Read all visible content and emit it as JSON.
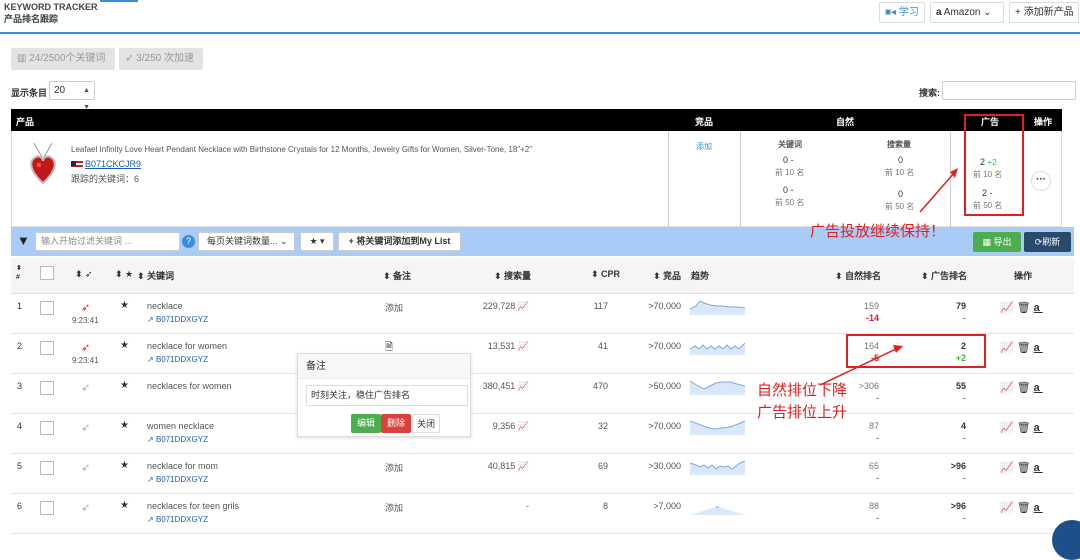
{
  "header": {
    "brand_en": "KEYWORD TRACKER",
    "brand_cn": "产品排名跟踪",
    "learn": "学习",
    "marketplace": "Amazon",
    "add_product": "添加新产品"
  },
  "stats": {
    "keywords": "24/2500个关键词",
    "boosts": "3/250 次加速"
  },
  "controls": {
    "show_label": "显示条目",
    "page_size": "20",
    "search_label": "搜索:"
  },
  "product_header": {
    "product": "产品",
    "competitor": "竞品",
    "organic": "自然",
    "ads": "广告",
    "actions": "操作"
  },
  "product": {
    "title": "Leafael Infinity Love Heart Pendant Necklace with Birthstone Crystals for 12 Months, Jewelry Gifts for Women, Silver-Tone, 18\"+2\"",
    "asin": "B071CKCJR9",
    "tracked": "跟踪的关键词：6",
    "competitor_add": "添加",
    "organic": {
      "kw_label": "关键词",
      "sv_label": "搜索量",
      "top10_kw": "0",
      "top10_kw_delta": "-",
      "top10_label": "前 10 名",
      "top10_sv": "0",
      "top50_kw": "0",
      "top50_kw_delta": "-",
      "top50_label": "前 50 名",
      "top50_sv": "0"
    },
    "ads": {
      "top10": "2",
      "top10_delta": "+2",
      "top10_label": "前 10 名",
      "top50": "2",
      "top50_delta": "-",
      "top50_label": "前 50 名"
    }
  },
  "toolbar": {
    "filter_placeholder": "输入开始过滤关键词 ...",
    "per_page": "每页关键词数量...",
    "add_mylist": "将关键词添加到My List",
    "export": "导出",
    "refresh": "刷新"
  },
  "columns": {
    "num": "#",
    "keyword": "关键词",
    "note": "备注",
    "search_volume": "搜索量",
    "cpr": "CPR",
    "competitor": "竞品",
    "trend": "趋势",
    "organic_rank": "自然排名",
    "ad_rank": "广告排名",
    "actions": "操作"
  },
  "rows": [
    {
      "n": "1",
      "time": "9:23:41",
      "kw": "necklace",
      "asin": "B071DDXGYZ",
      "note": "添加",
      "sv": "229,728",
      "cpr": "117",
      "comp": ">70,000",
      "org": "159",
      "org_d": "-14",
      "ad": "79",
      "ad_d": "-"
    },
    {
      "n": "2",
      "time": "9:23:41",
      "kw": "necklace for women",
      "asin": "B071DDXGYZ",
      "note": "",
      "sv": "13,531",
      "cpr": "41",
      "comp": ">70,000",
      "org": "164",
      "org_d": "-5",
      "ad": "2",
      "ad_d": "+2"
    },
    {
      "n": "3",
      "time": "",
      "kw": "necklaces for women",
      "asin": "",
      "note": "",
      "sv": "380,451",
      "cpr": "470",
      "comp": ">50,000",
      "org": ">306",
      "org_d": "-",
      "ad": "55",
      "ad_d": "-"
    },
    {
      "n": "4",
      "time": "",
      "kw": "women necklace",
      "asin": "B071DDXGYZ",
      "note": "",
      "sv": "9,356",
      "cpr": "32",
      "comp": ">70,000",
      "org": "87",
      "org_d": "-",
      "ad": "4",
      "ad_d": "-"
    },
    {
      "n": "5",
      "time": "",
      "kw": "necklace for mom",
      "asin": "B071DDXGYZ",
      "note": "添加",
      "sv": "40,815",
      "cpr": "69",
      "comp": ">30,000",
      "org": "65",
      "org_d": "-",
      "ad": ">96",
      "ad_d": "-"
    },
    {
      "n": "6",
      "time": "",
      "kw": "necklaces for teen grils",
      "asin": "B071DDXGYZ",
      "note": "添加",
      "sv": "-",
      "cpr": "8",
      "comp": ">7,000",
      "org": "88",
      "org_d": "-",
      "ad": ">96",
      "ad_d": "-"
    }
  ],
  "popup": {
    "title": "备注",
    "text": "时刻关注，稳住广告排名",
    "edit": "编辑",
    "delete": "删除",
    "close": "关闭"
  },
  "annotations": {
    "a1": "广告投放继续保持！",
    "a2_line1": "自然排位下降",
    "a2_line2": "广告排位上升"
  }
}
